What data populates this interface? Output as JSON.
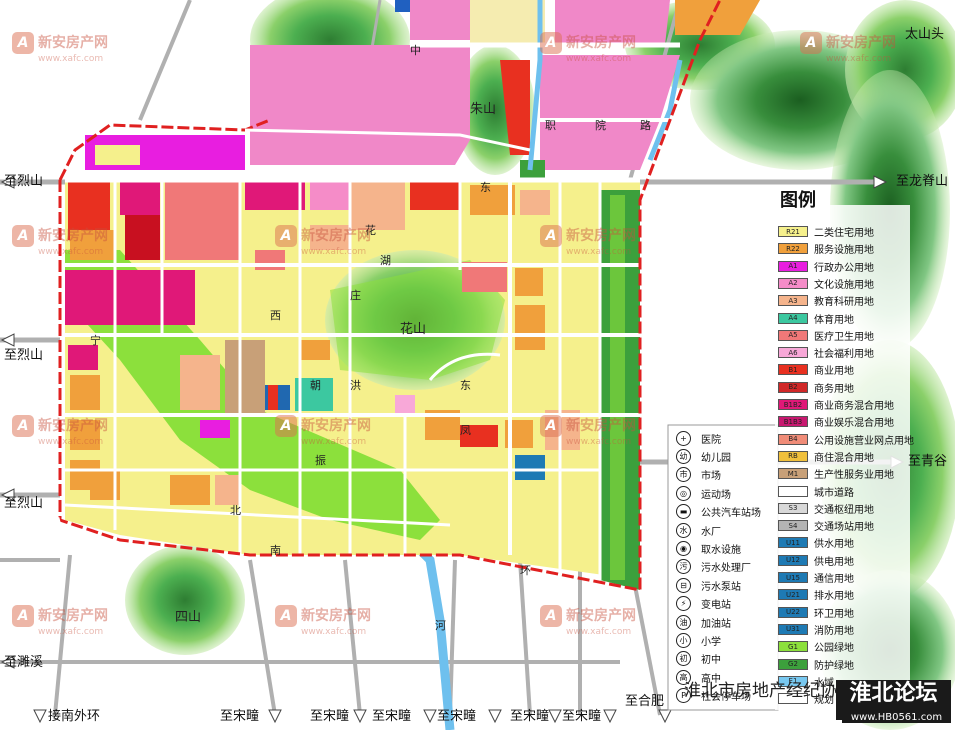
{
  "legend": {
    "title": "图例",
    "items": [
      {
        "code": "R21",
        "label": "二类住宅用地",
        "color": "#f5f08c"
      },
      {
        "code": "R22",
        "label": "服务设施用地",
        "color": "#f0a03c"
      },
      {
        "code": "A1",
        "label": "行政办公用地",
        "color": "#e81ee0"
      },
      {
        "code": "A2",
        "label": "文化设施用地",
        "color": "#f58cc8"
      },
      {
        "code": "A3",
        "label": "教育科研用地",
        "color": "#f5b48c"
      },
      {
        "code": "A4",
        "label": "体育用地",
        "color": "#3cc8a0"
      },
      {
        "code": "A5",
        "label": "医疗卫生用地",
        "color": "#f07878"
      },
      {
        "code": "A6",
        "label": "社会福利用地",
        "color": "#f8a8d8"
      },
      {
        "code": "B1",
        "label": "商业用地",
        "color": "#e83020"
      },
      {
        "code": "B2",
        "label": "商务用地",
        "color": "#d02828"
      },
      {
        "code": "B1B2",
        "label": "商业商务混合用地",
        "color": "#e01878"
      },
      {
        "code": "B1B3",
        "label": "商业娱乐混合用地",
        "color": "#c81870"
      },
      {
        "code": "B4",
        "label": "公用设施营业网点用地",
        "color": "#f08c78"
      },
      {
        "code": "RB",
        "label": "商住混合用地",
        "color": "#f0c03c"
      },
      {
        "code": "M1",
        "label": "生产性服务业用地",
        "color": "#c8a078"
      },
      {
        "code": "",
        "label": "城市道路",
        "color": "#ffffff"
      },
      {
        "code": "S3",
        "label": "交通枢纽用地",
        "color": "#d8d8d8"
      },
      {
        "code": "S4",
        "label": "交通场站用地",
        "color": "#b4b4b4"
      },
      {
        "code": "U11",
        "label": "供水用地",
        "color": "#1e7ab4"
      },
      {
        "code": "U12",
        "label": "供电用地",
        "color": "#1e7ab4"
      },
      {
        "code": "U15",
        "label": "通信用地",
        "color": "#1e7ab4"
      },
      {
        "code": "U21",
        "label": "排水用地",
        "color": "#1e7ab4"
      },
      {
        "code": "U22",
        "label": "环卫用地",
        "color": "#1e7ab4"
      },
      {
        "code": "U31",
        "label": "消防用地",
        "color": "#1e7ab4"
      },
      {
        "code": "G1",
        "label": "公园绿地",
        "color": "#8ce03c"
      },
      {
        "code": "G2",
        "label": "防护绿地",
        "color": "#3ca03c"
      },
      {
        "code": "E1",
        "label": "水域",
        "color": "#78c8f0"
      },
      {
        "code": "",
        "label": "规划",
        "color": "#ffffff"
      }
    ]
  },
  "symbols": [
    {
      "glyph": "+",
      "label": "医院"
    },
    {
      "glyph": "幼",
      "label": "幼儿园"
    },
    {
      "glyph": "市",
      "label": "市场"
    },
    {
      "glyph": "◎",
      "label": "运动场"
    },
    {
      "glyph": "▬",
      "label": "公共汽车站场"
    },
    {
      "glyph": "水",
      "label": "水厂"
    },
    {
      "glyph": "◉",
      "label": "取水设施"
    },
    {
      "glyph": "污",
      "label": "污水处理厂"
    },
    {
      "glyph": "⊟",
      "label": "污水泵站"
    },
    {
      "glyph": "⚡",
      "label": "变电站"
    },
    {
      "glyph": "油",
      "label": "加油站"
    },
    {
      "glyph": "小",
      "label": "小学"
    },
    {
      "glyph": "初",
      "label": "初中"
    },
    {
      "glyph": "高",
      "label": "高中"
    },
    {
      "glyph": "P",
      "label": "社会停车场"
    }
  ],
  "directions": {
    "lieshan_1": "至烈山",
    "lieshan_2": "至烈山",
    "lieshan_3": "至烈山",
    "longjishan": "至龙脊山",
    "qingyi": "至青谷",
    "suixi": "至濉溪",
    "jienan": "接南外环",
    "songtong_1": "至宋疃",
    "songtong_2": "至宋疃",
    "songtong_3": "至宋疃",
    "songtong_4": "至宋疃",
    "songtong_5": "至宋疃",
    "songtong_6": "至宋疃",
    "hefei": "至合肥",
    "taishantou": "太山头"
  },
  "places": {
    "zhushan": "朱山",
    "huashan": "花山",
    "sishan": "四山"
  },
  "road_labels": {
    "zhong": "中",
    "lu1": "路",
    "zhi": "职",
    "yuan": "院",
    "lu2": "路",
    "lu3": "路",
    "dong": "东",
    "lu4": "路",
    "hua": "花",
    "hu": "湖",
    "lu5": "路",
    "xi": "西",
    "lu6": "路",
    "chao": "朝",
    "hong": "洪",
    "lu7": "路",
    "dong2": "东",
    "feng": "凤",
    "lu8": "路",
    "lu9": "路",
    "bei": "北",
    "lu10": "路",
    "lu11": "路",
    "zhen": "振",
    "lu12": "路",
    "lu13": "路",
    "nan": "南",
    "lu14": "路",
    "yu": "玉",
    "mao": "茂",
    "xin": "新",
    "ji": "集",
    "lu15": "路",
    "dong3": "东",
    "kang": "康",
    "lu16": "路",
    "dong4": "东",
    "lu17": "路",
    "ta": "塔",
    "qiao": "桥",
    "lu18": "路",
    "huan": "环",
    "he": "河",
    "ning": "宁",
    "jin": "金",
    "lu19": "路",
    "lu20": "路",
    "lu21": "路",
    "zhuang": "庄",
    "lu22": "路",
    "lu23": "路",
    "lu24": "路",
    "lu25": "路",
    "gong": "工",
    "xiang": "巷",
    "lu26": "路",
    "lu27": "路"
  },
  "watermarks": {
    "brand": "新安房产网",
    "domain": "www.xafc.com"
  },
  "footer": {
    "association": "淮北市房地产经纪协会",
    "forum": "淮北论坛",
    "url": "www.HB0561.com"
  }
}
